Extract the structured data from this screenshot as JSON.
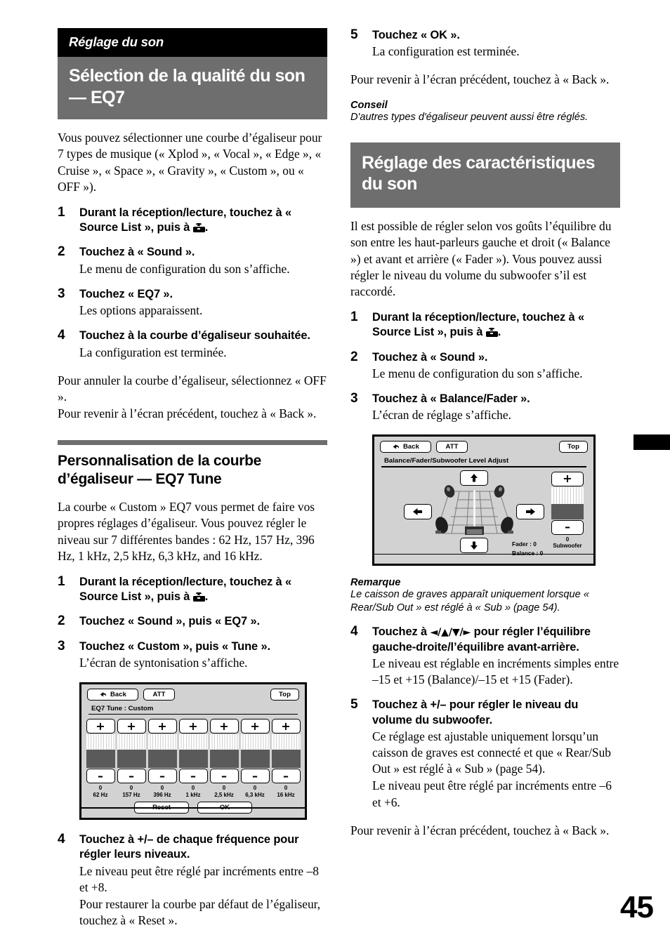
{
  "page_number": "45",
  "left_column": {
    "section_kicker": "Réglage du son",
    "section_title": "Sélection de la qualité du son — EQ7",
    "intro": "Vous pouvez sélectionner une courbe d’égaliseur pour 7 types de musique (« Xplod », « Vocal », « Edge », « Cruise », « Space », « Gravity », « Custom », ou « OFF »).",
    "steps": [
      {
        "num": "1",
        "head_before_icon": "Durant la réception/lecture, touchez à « Source List », puis à ",
        "icon": "toolbox-icon",
        "head_after_icon": ".",
        "sub": ""
      },
      {
        "num": "2",
        "head": "Touchez à « Sound ».",
        "sub": "Le menu de configuration du son s’affiche."
      },
      {
        "num": "3",
        "head": "Touchez « EQ7 ».",
        "sub": "Les options apparaissent."
      },
      {
        "num": "4",
        "head": "Touchez à la courbe d’égaliseur souhaitée.",
        "sub": "La configuration est terminée."
      }
    ],
    "after_steps_1": "Pour annuler la courbe d’égaliseur, sélectionnez « OFF ».",
    "after_steps_2": "Pour revenir à l’écran précédent, touchez à « Back ».",
    "subsection_title": "Personnalisation de la courbe d’égaliseur — EQ7 Tune",
    "subsection_intro": "La courbe « Custom » EQ7 vous permet de faire vos propres réglages d’égaliseur. Vous pouvez régler le niveau sur 7 différentes bandes : 62 Hz, 157 Hz, 396 Hz, 1 kHz, 2,5 kHz, 6,3 kHz, and 16 kHz.",
    "steps2": [
      {
        "num": "1",
        "head_before_icon": "Durant la réception/lecture, touchez à « Source List », puis à ",
        "icon": "toolbox-icon",
        "head_after_icon": ".",
        "sub": ""
      },
      {
        "num": "2",
        "head": "Touchez « Sound », puis « EQ7 ».",
        "sub": ""
      },
      {
        "num": "3",
        "head": "Touchez « Custom », puis « Tune ».",
        "sub": "L’écran de syntonisation s’affiche."
      }
    ],
    "step4": {
      "num": "4",
      "head": "Touchez à +/– de chaque fréquence pour régler leurs niveaux.",
      "sub1": "Le niveau peut être réglé par incréments entre –8 et +8.",
      "sub2": "Pour restaurer la courbe par défaut de l’égaliseur, touchez à « Reset »."
    }
  },
  "eq_screen": {
    "back_label": "Back",
    "att_label": "ATT",
    "top_label": "Top",
    "title": "EQ7 Tune : Custom",
    "plus_label": "+",
    "minus_label": "–",
    "bands": [
      {
        "value": "0",
        "freq": "62 Hz"
      },
      {
        "value": "0",
        "freq": "157 Hz"
      },
      {
        "value": "0",
        "freq": "396 Hz"
      },
      {
        "value": "0",
        "freq": "1 kHz"
      },
      {
        "value": "0",
        "freq": "2,5 kHz"
      },
      {
        "value": "0",
        "freq": "6,3 kHz"
      },
      {
        "value": "0",
        "freq": "16 kHz"
      }
    ],
    "reset_label": "Reset",
    "ok_label": "OK"
  },
  "right_column": {
    "step5": {
      "num": "5",
      "head": "Touchez « OK ».",
      "sub": "La configuration est terminée."
    },
    "after_step5": "Pour revenir à l’écran précédent, touchez à « Back ».",
    "tip_label": "Conseil",
    "tip_body": "D'autres types d'égaliseur peuvent aussi être réglés.",
    "section_title": "Réglage des caractéristiques du son",
    "intro": "Il est possible de régler selon vos goûts l’équilibre du son entre les haut-parleurs gauche et droit (« Balance ») et avant et arrière (« Fader »). Vous pouvez aussi régler le niveau du volume du subwoofer s’il est raccordé.",
    "steps": [
      {
        "num": "1",
        "head_before_icon": "Durant la réception/lecture, touchez à « Source List », puis à ",
        "icon": "toolbox-icon",
        "head_after_icon": ".",
        "sub": ""
      },
      {
        "num": "2",
        "head": "Touchez à « Sound ».",
        "sub": "Le menu de configuration du son s’affiche."
      },
      {
        "num": "3",
        "head": "Touchez à « Balance/Fader ».",
        "sub": "L’écran de réglage s’affiche."
      }
    ],
    "note_label": "Remarque",
    "note_body": "Le caisson de graves apparaît uniquement lorsque « Rear/Sub Out » est réglé à « Sub » (page 54).",
    "step4": {
      "num": "4",
      "head_part1": "Touchez à ",
      "head_arrows": "◄/▲/▼/►",
      "head_part2": " pour régler l’équilibre gauche-droite/l’équilibre avant-arrière.",
      "sub": "Le niveau est réglable en incréments simples entre –15 et +15 (Balance)/–15 et +15 (Fader)."
    },
    "step5b": {
      "num": "5",
      "head": "Touchez à +/– pour régler le niveau du volume du subwoofer.",
      "sub1": "Ce réglage est ajustable uniquement lorsqu’un caisson de graves est connecté et que « Rear/Sub Out » est réglé à « Sub » (page 54).",
      "sub2": "Le niveau peut être réglé par incréments entre –6 et +6."
    },
    "closing": "Pour revenir à l’écran précédent, touchez à « Back »."
  },
  "balance_screen": {
    "back_label": "Back",
    "att_label": "ATT",
    "top_label": "Top",
    "title": "Balance/Fader/Subwoofer Level Adjust",
    "up_arrow": "▲",
    "down_arrow": "▼",
    "left_arrow": "◄",
    "right_arrow": "►",
    "fader_readout": "Fader : 0",
    "balance_readout": "Balance : 0",
    "subwoofer_plus": "+",
    "subwoofer_minus": "–",
    "subwoofer_value": "0",
    "subwoofer_label": "Subwoofer"
  },
  "colors": {
    "kicker_band": "#000000",
    "title_band": "#6e6e6e",
    "screen_bg": "#d2d2d2",
    "slider_fill": "#5a5a5a"
  }
}
